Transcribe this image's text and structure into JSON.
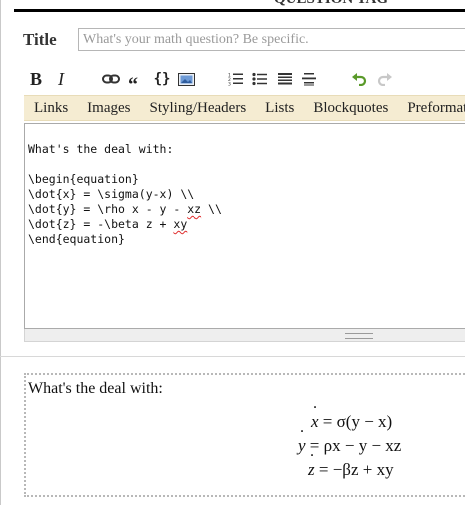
{
  "header": {
    "cut_text": "QUESTION  TAG"
  },
  "title": {
    "label": "Title",
    "placeholder": "What's your math question? Be specific."
  },
  "toolbar": {
    "bold": "B",
    "italic": "I",
    "blockquote": "“",
    "code": "{}",
    "icons": [
      "link-icon",
      "blockquote-icon",
      "code-icon",
      "image-icon",
      "numbered-list-icon",
      "bulleted-list-icon",
      "heading-icon",
      "horizontal-rule-icon",
      "undo-icon",
      "redo-icon"
    ]
  },
  "help_tabs": [
    "Links",
    "Images",
    "Styling/Headers",
    "Lists",
    "Blockquotes",
    "Preformatted"
  ],
  "editor": {
    "l0": "What's the deal with:",
    "l1": "\\begin{equation}",
    "l2": "\\dot{x} = \\sigma(y-x) \\\\",
    "l3a": "\\dot{y} = \\rho x - y - ",
    "l3b": "xz",
    "l3c": " \\\\",
    "l4a": "\\dot{z} = -\\beta z + ",
    "l4b": "xy",
    "l5": "\\end{equation}"
  },
  "preview": {
    "intro": "What's the deal with:",
    "eq1": {
      "lhs": "x",
      "rhs": "= σ(y − x)"
    },
    "eq2": {
      "lhs": "y",
      "rhs": "= ρx − y − xz"
    },
    "eq3": {
      "lhs": "z",
      "rhs": "= −βz + xy"
    }
  },
  "colors": {
    "help_bar_bg": "#f5ecd2",
    "undo_green": "#5a9a2a",
    "redo_gray": "#c8c8c8",
    "spell_error": "#e02b2b"
  }
}
